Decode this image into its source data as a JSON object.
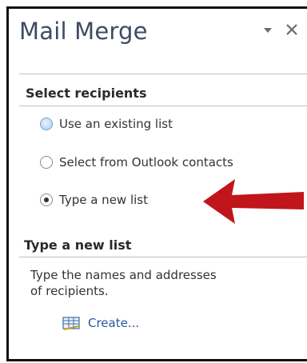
{
  "pane": {
    "title": "Mail Merge"
  },
  "select_recipients": {
    "header": "Select recipients",
    "options": [
      {
        "label": "Use an existing list",
        "state": "focused"
      },
      {
        "label": "Select from Outlook contacts",
        "state": "unchecked"
      },
      {
        "label": "Type a new list",
        "state": "checked"
      }
    ]
  },
  "type_new_list": {
    "header": "Type a new list",
    "description": "Type the names and addresses of recipients.",
    "create_link": "Create...",
    "create_icon": "table-edit-icon"
  },
  "colors": {
    "title": "#3f4a64",
    "link": "#2a579a",
    "arrow": "#c0151b",
    "radio_focus": "#6fa4d8"
  }
}
